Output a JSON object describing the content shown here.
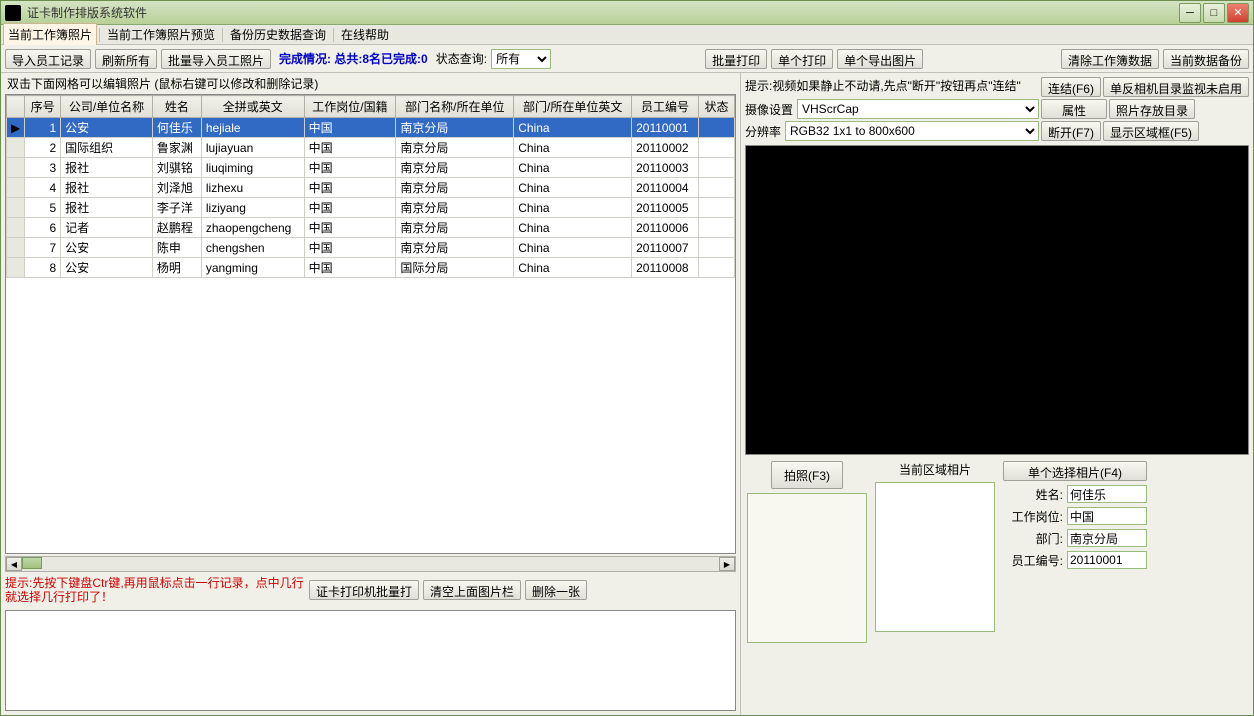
{
  "window": {
    "title": "证卡制作排版系统软件"
  },
  "menu": {
    "tab1": "当前工作簿照片",
    "tab2": "当前工作簿照片预览",
    "tab3": "备份历史数据查询",
    "tab4": "在线帮助"
  },
  "toolbar": {
    "import": "导入员工记录",
    "refresh": "刷新所有",
    "batch_import": "批量导入员工照片",
    "status_prefix": "完成情况: 总共:8名已完成:0",
    "status_query_label": "状态查询:",
    "status_all": "所有",
    "batch_print": "批量打印",
    "single_print": "单个打印",
    "single_export": "单个导出图片",
    "clear_wb": "清除工作簿数据",
    "backup": "当前数据备份"
  },
  "grid_hint": "双击下面网格可以编辑照片 (鼠标右键可以修改和删除记录)",
  "grid": {
    "headers": [
      "序号",
      "公司/单位名称",
      "姓名",
      "全拼或英文",
      "工作岗位/国籍",
      "部门名称/所在单位",
      "部门/所在单位英文",
      "员工编号",
      "状态"
    ],
    "rows": [
      {
        "n": "1",
        "co": "公安",
        "name": "何佳乐",
        "py": "hejiale",
        "job": "中国",
        "dept": "南京分局",
        "depte": "China",
        "eid": "20110001"
      },
      {
        "n": "2",
        "co": "国际组织",
        "name": "鲁家渊",
        "py": "lujiayuan",
        "job": "中国",
        "dept": "南京分局",
        "depte": "China",
        "eid": "20110002"
      },
      {
        "n": "3",
        "co": "报社",
        "name": "刘骐铭",
        "py": "liuqiming",
        "job": "中国",
        "dept": "南京分局",
        "depte": "China",
        "eid": "20110003"
      },
      {
        "n": "4",
        "co": "报社",
        "name": "刘泽旭",
        "py": "lizhexu",
        "job": "中国",
        "dept": "南京分局",
        "depte": "China",
        "eid": "20110004"
      },
      {
        "n": "5",
        "co": "报社",
        "name": "李子洋",
        "py": "liziyang",
        "job": "中国",
        "dept": "南京分局",
        "depte": "China",
        "eid": "20110005"
      },
      {
        "n": "6",
        "co": "记者",
        "name": "赵鹏程",
        "py": "zhaopengcheng",
        "job": "中国",
        "dept": "南京分局",
        "depte": "China",
        "eid": "20110006"
      },
      {
        "n": "7",
        "co": "公安",
        "name": "陈申",
        "py": "chengshen",
        "job": "中国",
        "dept": "南京分局",
        "depte": "China",
        "eid": "20110007"
      },
      {
        "n": "8",
        "co": "公安",
        "name": "杨明",
        "py": "yangming",
        "job": "中国",
        "dept": "国际分局",
        "depte": "China",
        "eid": "20110008"
      }
    ]
  },
  "bottom": {
    "hint": "提示:先按下键盘Ctr键,再用鼠标点击一行记录，点中几行就选择几行打印了！",
    "card_print": "证卡打印机批量打",
    "clear_gallery": "清空上面图片栏",
    "del_one": "删除一张"
  },
  "cam": {
    "hint": "提示:视频如果静止不动请,先点\"断开\"按钮再点\"连结\"",
    "device_label": "摄像设置",
    "device": "VHScrCap",
    "res_label": "分辨率",
    "res": "RGB32 1x1 to 800x600",
    "connect": "连结(F6)",
    "slr_monitor": "单反相机目录监视未启用",
    "props": "属性",
    "photo_dir": "照片存放目录",
    "disconnect": "断开(F7)",
    "show_region": "显示区域框(F5)",
    "capture": "拍照(F3)",
    "region_label": "当前区域相片",
    "select_photo": "单个选择相片(F4)",
    "f_name": "姓名:",
    "f_job": "工作岗位:",
    "f_dept": "部门:",
    "f_eid": "员工编号:",
    "v_name": "何佳乐",
    "v_job": "中国",
    "v_dept": "南京分局",
    "v_eid": "20110001"
  }
}
